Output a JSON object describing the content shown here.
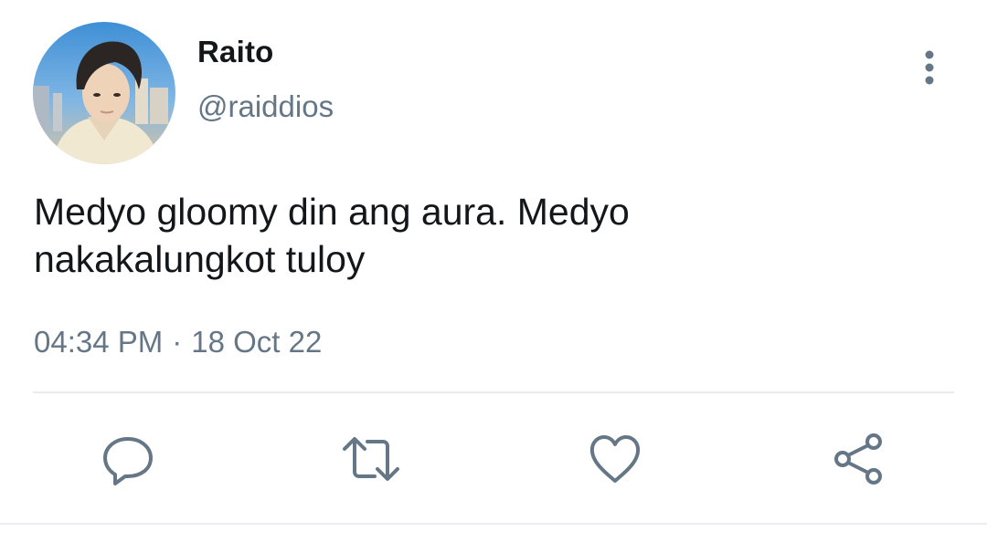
{
  "tweet": {
    "author": {
      "display_name": "Raito",
      "handle": "@raiddios"
    },
    "text_line1": "Medyo gloomy din ang aura. Medyo",
    "text_line2": "nakakalungkot tuloy",
    "time": "04:34 PM",
    "separator": "·",
    "date": "18 Oct 22"
  },
  "icons": {
    "more": "more-vertical-icon",
    "reply": "reply-icon",
    "retweet": "retweet-icon",
    "like": "heart-icon",
    "share": "share-icon"
  },
  "colors": {
    "text": "#14171a",
    "secondary": "#657786",
    "icon": "#657786",
    "divider": "#e6ecf0"
  }
}
